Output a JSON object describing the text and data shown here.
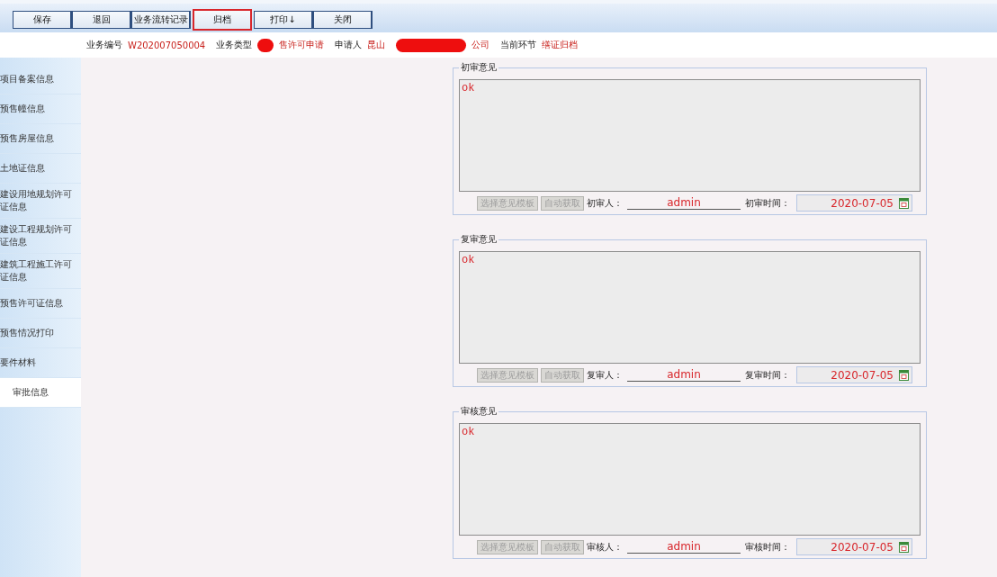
{
  "toolbar": [
    {
      "label": "保存",
      "highlighted": false
    },
    {
      "label": "退回",
      "highlighted": false
    },
    {
      "label": "业务流转记录",
      "highlighted": false
    },
    {
      "label": "归档",
      "highlighted": true
    },
    {
      "label": "打印↓",
      "highlighted": false
    },
    {
      "label": "关闭",
      "highlighted": false
    }
  ],
  "info": [
    {
      "label": "业务编号",
      "value": "W202007050004"
    },
    {
      "label": "业务类型",
      "value": "售许可申请",
      "redacted": true
    },
    {
      "label": "申请人",
      "value": "昆山",
      "value_after": "公司",
      "redacted": true
    },
    {
      "label": "当前环节",
      "value": "缮证归档"
    }
  ],
  "sidebar": {
    "items": [
      {
        "label": "项目备案信息",
        "selected": false
      },
      {
        "label": "预售幢信息",
        "selected": false
      },
      {
        "label": "预售房屋信息",
        "selected": false
      },
      {
        "label": "土地证信息",
        "selected": false
      },
      {
        "label": "建设用地规划许可证信息",
        "selected": false
      },
      {
        "label": "建设工程规划许可证信息",
        "selected": false
      },
      {
        "label": "建筑工程施工许可证信息",
        "selected": false
      },
      {
        "label": "预售许可证信息",
        "selected": false
      },
      {
        "label": "预售情况打印",
        "selected": false
      },
      {
        "label": "要件材料",
        "selected": false
      },
      {
        "label": "审批信息",
        "selected": true
      }
    ]
  },
  "sections": [
    {
      "legend": "初审意见",
      "opinion": "ok",
      "template_button": {
        "label": "选择意见模板",
        "disabled": true
      },
      "auto_button": {
        "label": "自动获取",
        "disabled": true
      },
      "person_label": "初审人：",
      "person": "admin",
      "time_label": "初审时间：",
      "time": "2020-07-05"
    },
    {
      "legend": "复审意见",
      "opinion": "ok",
      "template_button": {
        "label": "选择意见模板",
        "disabled": true
      },
      "auto_button": {
        "label": "自动获取",
        "disabled": true
      },
      "person_label": "复审人：",
      "person": "admin",
      "time_label": "复审时间：",
      "time": "2020-07-05"
    },
    {
      "legend": "审核意见",
      "opinion": "ok",
      "template_button": {
        "label": "选择意见模板",
        "disabled": true
      },
      "auto_button": {
        "label": "自动获取",
        "disabled": true
      },
      "person_label": "审核人：",
      "person": "admin",
      "time_label": "审核时间：",
      "time": "2020-07-05"
    }
  ]
}
